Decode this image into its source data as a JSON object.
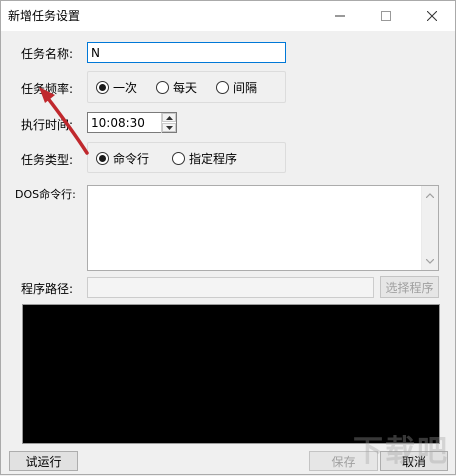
{
  "window": {
    "title": "新增任务设置",
    "minimize_glyph": "—",
    "maximize_glyph": "□",
    "close_glyph": "✕"
  },
  "task_name": {
    "label": "任务名称:",
    "value": "N"
  },
  "frequency": {
    "label": "任务频率:",
    "options": [
      {
        "label": "一次",
        "checked": true
      },
      {
        "label": "每天",
        "checked": false
      },
      {
        "label": "间隔",
        "checked": false
      }
    ]
  },
  "exec_time": {
    "label": "执行时间:",
    "value": "10:08:30"
  },
  "task_type": {
    "label": "任务类型:",
    "options": [
      {
        "label": "命令行",
        "checked": true
      },
      {
        "label": "指定程序",
        "checked": false
      }
    ]
  },
  "dos_command": {
    "label": "DOS命令行:",
    "value": ""
  },
  "program_path": {
    "label": "程序路径:",
    "value": "",
    "browse_label": "选择程序"
  },
  "buttons": {
    "test_run": "试运行",
    "save": "保存",
    "cancel": "取消"
  },
  "watermark": "下载吧",
  "colors": {
    "annotation_arrow": "#c0282d",
    "focus_border": "#0078d7",
    "console_bg": "#000000"
  }
}
